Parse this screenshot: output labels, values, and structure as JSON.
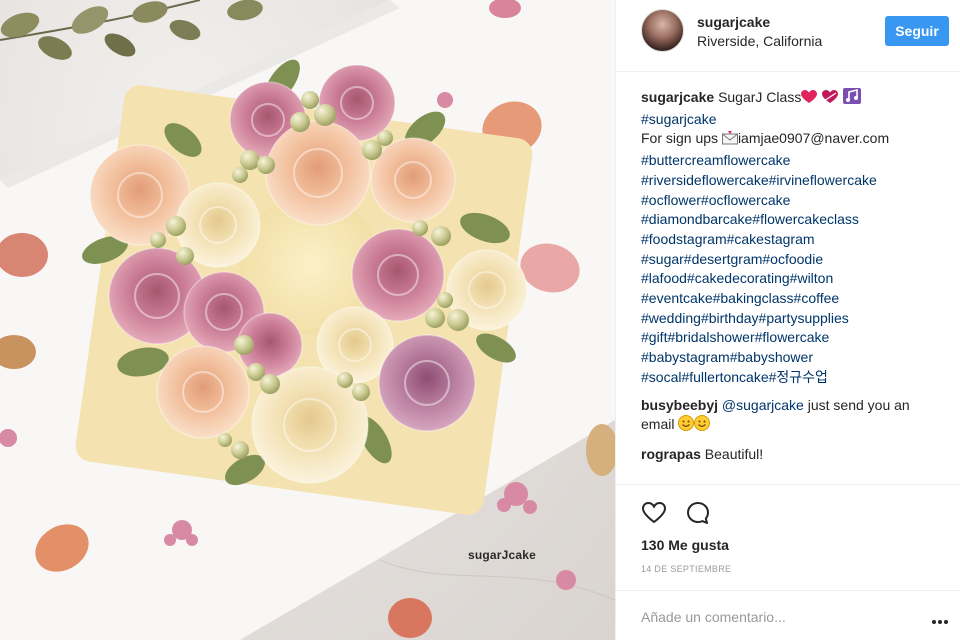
{
  "post": {
    "watermark": "sugarJcake",
    "header": {
      "username": "sugarjcake",
      "location": "Riverside, California",
      "follow_label": "Seguir"
    },
    "caption": {
      "username": "sugarjcake",
      "title": "SugarJ Class",
      "line1": "#sugarjcake",
      "signup_prefix": "For sign ups ",
      "signup_email": "iamjae0907@naver.com",
      "tags": [
        "#buttercreamflowercake",
        "#riversideflowercake#irvineflowercake",
        "#ocflower#ocflowercake",
        "#diamondbarcake#flowercakeclass",
        "#foodstagram#cakestagram",
        "#sugar#desertgram#ocfoodie",
        "#lafood#cakedecorating#wilton",
        "#eventcake#bakingclass#coffee",
        "#wedding#birthday#partysupplies",
        "#gift#bridalshower#flowercake",
        "#babystagram#babyshower",
        "#socal#fullertoncake#정규수업"
      ]
    },
    "comments": [
      {
        "user": "busybeebyj",
        "mention": "@sugarjcake",
        "text": " just send you an",
        "text2": "email "
      },
      {
        "user": "rograpas",
        "text": " Beautiful!"
      }
    ],
    "likes_label": "130 Me gusta",
    "date_label": "14 de septiembre",
    "comment_placeholder": "Añade un comentario...",
    "more_label": "•••",
    "icons": [
      "heart-icon",
      "comment-icon",
      "more-options-icon"
    ],
    "colors": {
      "follow": "#3897f0",
      "hashtag": "#003569",
      "muted": "#999999"
    }
  }
}
